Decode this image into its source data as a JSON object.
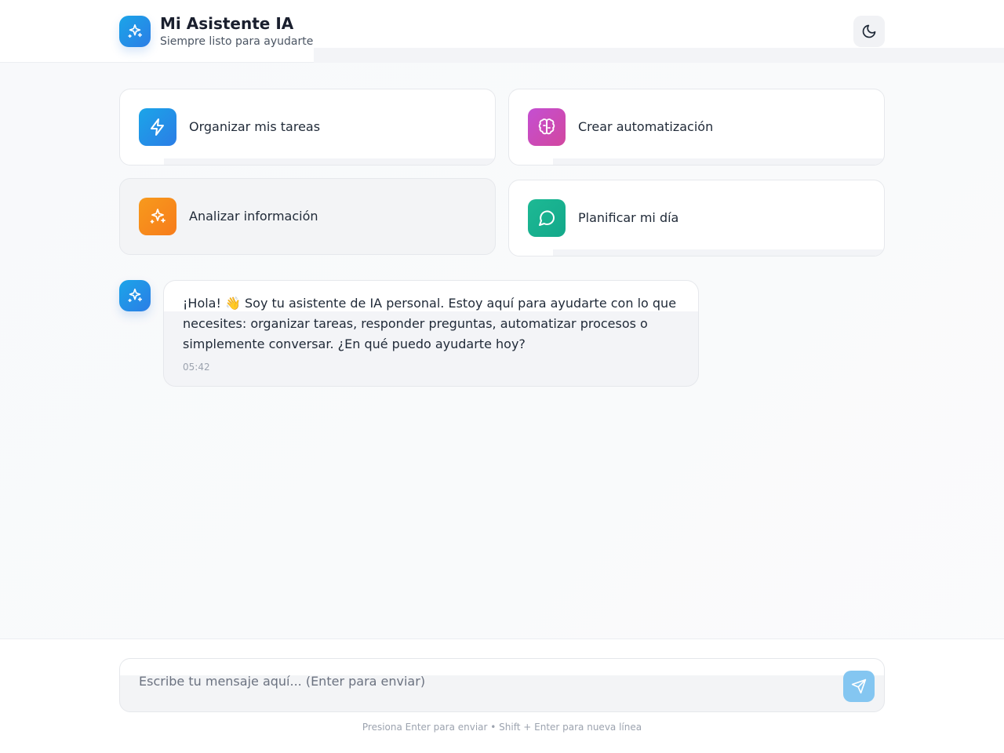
{
  "header": {
    "title": "Mi Asistente IA",
    "subtitle": "Siempre listo para ayudarte",
    "logo_icon": "sparkles-icon",
    "theme_toggle_icon": "moon-icon"
  },
  "quick_actions": [
    {
      "label": "Organizar mis tareas",
      "icon": "lightning-icon",
      "color": "#1f8fe6"
    },
    {
      "label": "Crear automatización",
      "icon": "brain-icon",
      "color": "#c64ed0"
    },
    {
      "label": "Analizar información",
      "icon": "sparkles-icon",
      "color": "#f7871b"
    },
    {
      "label": "Planificar mi día",
      "icon": "message-circle-icon",
      "color": "#18b48f"
    }
  ],
  "messages": [
    {
      "role": "assistant",
      "text": "¡Hola! 👋 Soy tu asistente de IA personal. Estoy aquí para ayudarte con lo que necesites: organizar tareas, responder preguntas, automatizar procesos o simplemente conversar. ¿En qué puedo ayudarte hoy?",
      "time": "05:42"
    }
  ],
  "composer": {
    "placeholder": "Escribe tu mensaje aquí... (Enter para enviar)",
    "value": "",
    "send_icon": "send-icon",
    "hint": "Presiona Enter para enviar • Shift + Enter para nueva línea"
  },
  "colors": {
    "accent": "#2b8fe6",
    "send_button": "#84c6f1"
  }
}
